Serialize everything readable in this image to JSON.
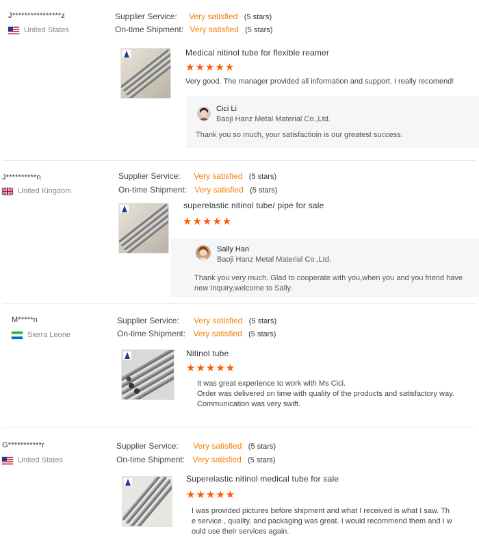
{
  "labels": {
    "supplier_service": "Supplier Service:",
    "ontime_shipment": "On-time Shipment:"
  },
  "colors": {
    "accent": "#f57c00",
    "stars": "#ff5a00"
  },
  "reviews": [
    {
      "buyer": "J****************z",
      "country": "United States",
      "flag": "us-flag-icon",
      "supplier_service": {
        "value": "Very satisfied",
        "stars": "(5 stars)"
      },
      "ontime_shipment": {
        "value": "Very satisfied",
        "stars": "(5 stars)"
      },
      "product_title": "Medical nitinol tube for flexible reamer",
      "product_rating": 5,
      "star_glyphs": "★★★★★",
      "comment": "Very good. The manager provided all information and support. I really recomend!",
      "reply": {
        "name": "Cici Li",
        "company": "Baoji Hanz Metal Material Co.,Ltd.",
        "text": "Thank you so much, your satisfactioin is our greatest success."
      }
    },
    {
      "buyer": "J**********n",
      "country": "United Kingdom",
      "flag": "uk-flag-icon",
      "supplier_service": {
        "value": "Very satisfied",
        "stars": "(5 stars)"
      },
      "ontime_shipment": {
        "value": "Very satisfied",
        "stars": "(5 stars)"
      },
      "product_title": "superelastic nitinol tube/ pipe for sale",
      "product_rating": 5,
      "star_glyphs": "★★★★★",
      "reply": {
        "name": "Sally Han",
        "company": "Baoji Hanz Metal Material Co.,Ltd.",
        "text": "Thank you very much. Glad to cooperate with you,when you and you friend have new Inquiry,welcome to Sally."
      }
    },
    {
      "buyer": "M*****n",
      "country": "Sierra Leone",
      "flag": "sierra-leone-flag-icon",
      "supplier_service": {
        "value": "Very satisfied",
        "stars": "(5 stars)"
      },
      "ontime_shipment": {
        "value": "Very satisfied",
        "stars": "(5 stars)"
      },
      "product_title": "Nitinol tube",
      "product_rating": 5,
      "star_glyphs": "★★★★★",
      "comment_lines": [
        "It was great experience to work with Ms Cici.",
        "Order was delivered on time with quality of the products and satisfactory way.",
        "Communication was very swift."
      ]
    },
    {
      "buyer": "G***********r",
      "country": "United States",
      "flag": "us-flag-icon",
      "supplier_service": {
        "value": "Very satisfied",
        "stars": "(5 stars)"
      },
      "ontime_shipment": {
        "value": "Very satisfied",
        "stars": "(5 stars)"
      },
      "product_title": "Superelastic nitinol medical tube for sale",
      "product_rating": 5,
      "star_glyphs": "★★★★★",
      "comment_lines": [
        "I was provided pictures before shipment and what I received is what I saw. Th",
        "e service , quality, and packaging was great. I would recommend them and I w",
        "ould use their services again."
      ]
    }
  ]
}
